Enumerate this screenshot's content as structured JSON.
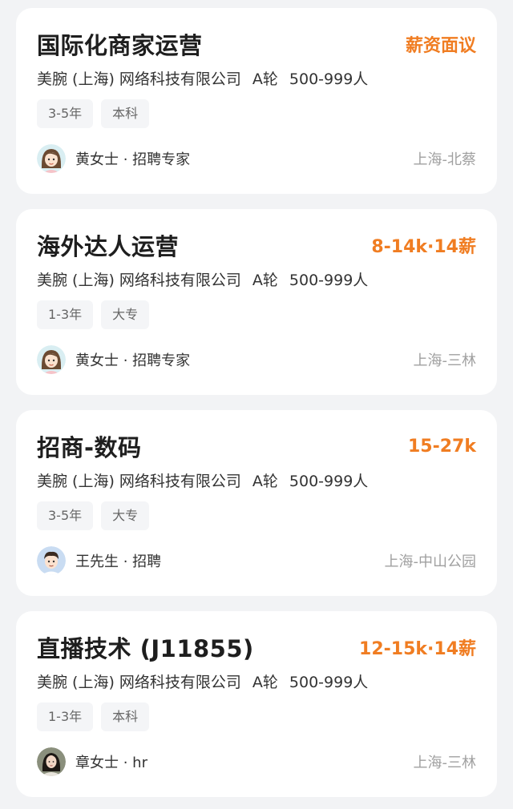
{
  "jobs": [
    {
      "title": "国际化商家运营",
      "salary": "薪资面议",
      "company": "美腕 (上海) 网络科技有限公司",
      "funding": "A轮",
      "size": "500-999人",
      "tags": [
        "3-5年",
        "本科"
      ],
      "recruiter": "黄女士 · 招聘专家",
      "avatar_icon": "woman-cartoon-avatar-icon",
      "location": "上海-北蔡"
    },
    {
      "title": "海外达人运营",
      "salary": "8-14k·14薪",
      "company": "美腕 (上海) 网络科技有限公司",
      "funding": "A轮",
      "size": "500-999人",
      "tags": [
        "1-3年",
        "大专"
      ],
      "recruiter": "黄女士 · 招聘专家",
      "avatar_icon": "woman-cartoon-avatar-icon",
      "location": "上海-三林"
    },
    {
      "title": "招商-数码",
      "salary": "15-27k",
      "company": "美腕 (上海) 网络科技有限公司",
      "funding": "A轮",
      "size": "500-999人",
      "tags": [
        "3-5年",
        "大专"
      ],
      "recruiter": "王先生 · 招聘",
      "avatar_icon": "man-cartoon-avatar-icon",
      "location": "上海-中山公园"
    },
    {
      "title": "直播技术 (J11855)",
      "salary": "12-15k·14薪",
      "company": "美腕 (上海) 网络科技有限公司",
      "funding": "A轮",
      "size": "500-999人",
      "tags": [
        "1-3年",
        "本科"
      ],
      "recruiter": "章女士 · hr",
      "avatar_icon": "woman-photo-avatar-icon",
      "location": "上海-三林"
    }
  ],
  "colors": {
    "salary": "#f07d22",
    "background": "#f2f3f5",
    "card": "#ffffff"
  }
}
